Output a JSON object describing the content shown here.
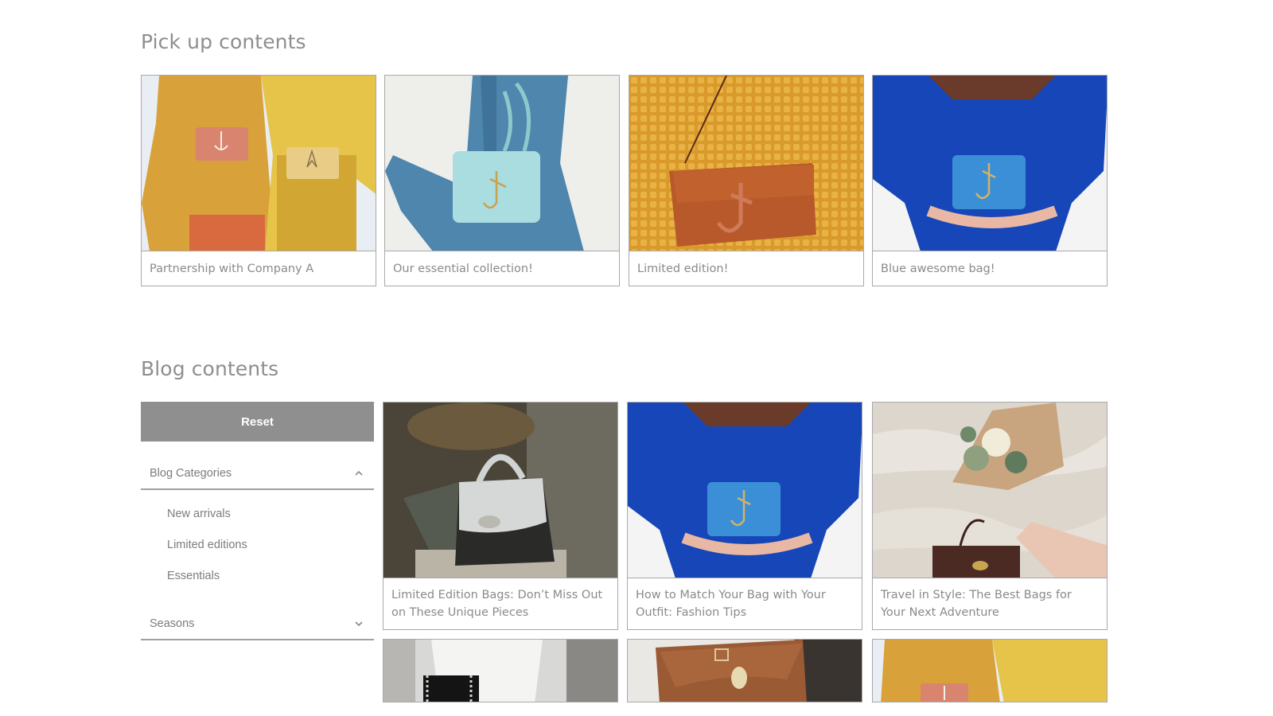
{
  "pickup": {
    "title": "Pick up contents",
    "cards": [
      {
        "caption": "Partnership with Company A",
        "image": "two models in mustard and yellow knitwear wearing pink and tan crossbody bags"
      },
      {
        "caption": "Our essential collection!",
        "image": "mint blue handbag held against blue corduroy outfit"
      },
      {
        "caption": "Limited edition!",
        "image": "tan leather bag over mustard waffle knit sweater"
      },
      {
        "caption": "Blue awesome bag!",
        "image": "blue bag held behind back of model in cobalt blue top"
      }
    ]
  },
  "blog": {
    "title": "Blog contents",
    "reset_label": "Reset",
    "filters": [
      {
        "label": "Blog Categories",
        "expanded": true,
        "items": [
          "New arrivals",
          "Limited editions",
          "Essentials"
        ]
      },
      {
        "label": "Seasons",
        "expanded": false,
        "items": []
      }
    ],
    "cards": [
      {
        "caption": "Limited Edition Bags: Don’t Miss Out on These Unique Pieces",
        "image": "white top-handle bag with twist lock beside dried flowers in shadow"
      },
      {
        "caption": "How to Match Your Bag with Your Outfit: Fashion Tips",
        "image": "blue bag held behind back of model in cobalt blue top"
      },
      {
        "caption": "Travel in Style: The Best Bags for Your Next Adventure",
        "image": "brown bag and flower bouquet held against stone wall"
      },
      {
        "caption": "",
        "image": "black quilted chain bag with white cable knit sweater"
      },
      {
        "caption": "",
        "image": "brown leather saddle bag with twist lock"
      },
      {
        "caption": "",
        "image": "models in mustard and yellow knitwear with pink bag"
      }
    ]
  },
  "colors": {
    "heading": "#8e8e8e",
    "text": "#8a8a8a",
    "button_bg": "#8f8f8f",
    "border": "#a9a9a9"
  }
}
